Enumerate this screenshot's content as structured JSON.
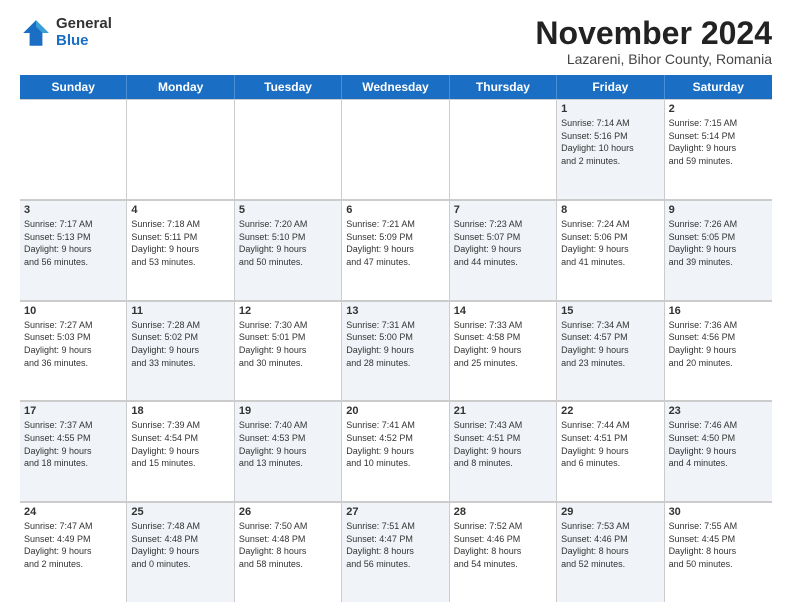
{
  "logo": {
    "general": "General",
    "blue": "Blue"
  },
  "title": "November 2024",
  "subtitle": "Lazareni, Bihor County, Romania",
  "header_days": [
    "Sunday",
    "Monday",
    "Tuesday",
    "Wednesday",
    "Thursday",
    "Friday",
    "Saturday"
  ],
  "weeks": [
    [
      {
        "day": "",
        "info": "",
        "shaded": false
      },
      {
        "day": "",
        "info": "",
        "shaded": false
      },
      {
        "day": "",
        "info": "",
        "shaded": false
      },
      {
        "day": "",
        "info": "",
        "shaded": false
      },
      {
        "day": "",
        "info": "",
        "shaded": false
      },
      {
        "day": "1",
        "info": "Sunrise: 7:14 AM\nSunset: 5:16 PM\nDaylight: 10 hours\nand 2 minutes.",
        "shaded": true
      },
      {
        "day": "2",
        "info": "Sunrise: 7:15 AM\nSunset: 5:14 PM\nDaylight: 9 hours\nand 59 minutes.",
        "shaded": false
      }
    ],
    [
      {
        "day": "3",
        "info": "Sunrise: 7:17 AM\nSunset: 5:13 PM\nDaylight: 9 hours\nand 56 minutes.",
        "shaded": true
      },
      {
        "day": "4",
        "info": "Sunrise: 7:18 AM\nSunset: 5:11 PM\nDaylight: 9 hours\nand 53 minutes.",
        "shaded": false
      },
      {
        "day": "5",
        "info": "Sunrise: 7:20 AM\nSunset: 5:10 PM\nDaylight: 9 hours\nand 50 minutes.",
        "shaded": true
      },
      {
        "day": "6",
        "info": "Sunrise: 7:21 AM\nSunset: 5:09 PM\nDaylight: 9 hours\nand 47 minutes.",
        "shaded": false
      },
      {
        "day": "7",
        "info": "Sunrise: 7:23 AM\nSunset: 5:07 PM\nDaylight: 9 hours\nand 44 minutes.",
        "shaded": true
      },
      {
        "day": "8",
        "info": "Sunrise: 7:24 AM\nSunset: 5:06 PM\nDaylight: 9 hours\nand 41 minutes.",
        "shaded": false
      },
      {
        "day": "9",
        "info": "Sunrise: 7:26 AM\nSunset: 5:05 PM\nDaylight: 9 hours\nand 39 minutes.",
        "shaded": true
      }
    ],
    [
      {
        "day": "10",
        "info": "Sunrise: 7:27 AM\nSunset: 5:03 PM\nDaylight: 9 hours\nand 36 minutes.",
        "shaded": false
      },
      {
        "day": "11",
        "info": "Sunrise: 7:28 AM\nSunset: 5:02 PM\nDaylight: 9 hours\nand 33 minutes.",
        "shaded": true
      },
      {
        "day": "12",
        "info": "Sunrise: 7:30 AM\nSunset: 5:01 PM\nDaylight: 9 hours\nand 30 minutes.",
        "shaded": false
      },
      {
        "day": "13",
        "info": "Sunrise: 7:31 AM\nSunset: 5:00 PM\nDaylight: 9 hours\nand 28 minutes.",
        "shaded": true
      },
      {
        "day": "14",
        "info": "Sunrise: 7:33 AM\nSunset: 4:58 PM\nDaylight: 9 hours\nand 25 minutes.",
        "shaded": false
      },
      {
        "day": "15",
        "info": "Sunrise: 7:34 AM\nSunset: 4:57 PM\nDaylight: 9 hours\nand 23 minutes.",
        "shaded": true
      },
      {
        "day": "16",
        "info": "Sunrise: 7:36 AM\nSunset: 4:56 PM\nDaylight: 9 hours\nand 20 minutes.",
        "shaded": false
      }
    ],
    [
      {
        "day": "17",
        "info": "Sunrise: 7:37 AM\nSunset: 4:55 PM\nDaylight: 9 hours\nand 18 minutes.",
        "shaded": true
      },
      {
        "day": "18",
        "info": "Sunrise: 7:39 AM\nSunset: 4:54 PM\nDaylight: 9 hours\nand 15 minutes.",
        "shaded": false
      },
      {
        "day": "19",
        "info": "Sunrise: 7:40 AM\nSunset: 4:53 PM\nDaylight: 9 hours\nand 13 minutes.",
        "shaded": true
      },
      {
        "day": "20",
        "info": "Sunrise: 7:41 AM\nSunset: 4:52 PM\nDaylight: 9 hours\nand 10 minutes.",
        "shaded": false
      },
      {
        "day": "21",
        "info": "Sunrise: 7:43 AM\nSunset: 4:51 PM\nDaylight: 9 hours\nand 8 minutes.",
        "shaded": true
      },
      {
        "day": "22",
        "info": "Sunrise: 7:44 AM\nSunset: 4:51 PM\nDaylight: 9 hours\nand 6 minutes.",
        "shaded": false
      },
      {
        "day": "23",
        "info": "Sunrise: 7:46 AM\nSunset: 4:50 PM\nDaylight: 9 hours\nand 4 minutes.",
        "shaded": true
      }
    ],
    [
      {
        "day": "24",
        "info": "Sunrise: 7:47 AM\nSunset: 4:49 PM\nDaylight: 9 hours\nand 2 minutes.",
        "shaded": false
      },
      {
        "day": "25",
        "info": "Sunrise: 7:48 AM\nSunset: 4:48 PM\nDaylight: 9 hours\nand 0 minutes.",
        "shaded": true
      },
      {
        "day": "26",
        "info": "Sunrise: 7:50 AM\nSunset: 4:48 PM\nDaylight: 8 hours\nand 58 minutes.",
        "shaded": false
      },
      {
        "day": "27",
        "info": "Sunrise: 7:51 AM\nSunset: 4:47 PM\nDaylight: 8 hours\nand 56 minutes.",
        "shaded": true
      },
      {
        "day": "28",
        "info": "Sunrise: 7:52 AM\nSunset: 4:46 PM\nDaylight: 8 hours\nand 54 minutes.",
        "shaded": false
      },
      {
        "day": "29",
        "info": "Sunrise: 7:53 AM\nSunset: 4:46 PM\nDaylight: 8 hours\nand 52 minutes.",
        "shaded": true
      },
      {
        "day": "30",
        "info": "Sunrise: 7:55 AM\nSunset: 4:45 PM\nDaylight: 8 hours\nand 50 minutes.",
        "shaded": false
      }
    ]
  ]
}
